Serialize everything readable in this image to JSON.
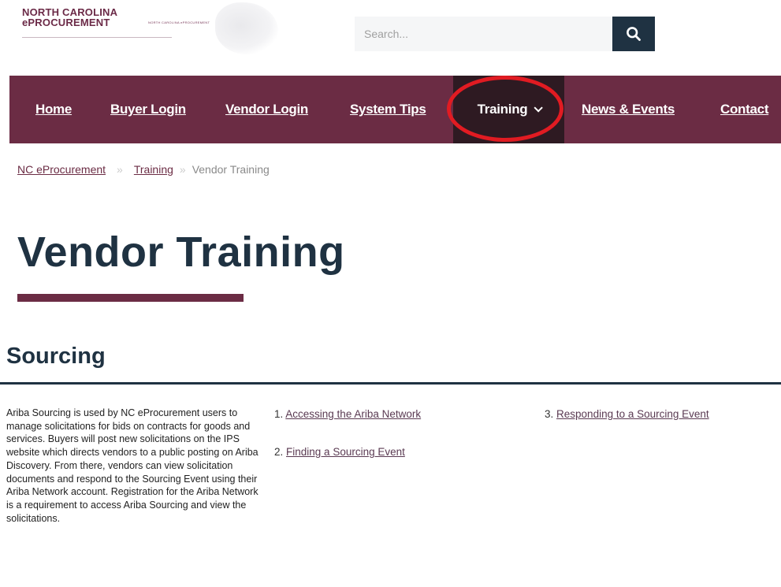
{
  "header": {
    "logo_line1": "NORTH CAROLINA",
    "logo_line2": "ePROCUREMENT",
    "logo_tagline": "NORTH CAROLINA ePROCUREMENT"
  },
  "search": {
    "placeholder": "Search...",
    "button_icon": "search-icon"
  },
  "nav": {
    "items": [
      {
        "label": "Home"
      },
      {
        "label": "Buyer Login"
      },
      {
        "label": "Vendor Login"
      },
      {
        "label": "System Tips"
      },
      {
        "label": "Training",
        "active": true,
        "icon": "chevron-down-icon"
      },
      {
        "label": "News & Events"
      },
      {
        "label": "Contact"
      }
    ],
    "highlight_color": "#e11b22"
  },
  "breadcrumb": {
    "items": [
      {
        "label": "NC eProcurement"
      },
      {
        "label": "Training"
      },
      {
        "label": "Vendor Training"
      }
    ]
  },
  "page": {
    "title": "Vendor Training",
    "section_title": "Sourcing",
    "description": "Ariba Sourcing is used by NC eProcurement users to manage solicitations for bids on contracts for goods and services. Buyers will post new solicitations on the IPS website which directs vendors to a public posting on Ariba Discovery. From there, vendors can view solicitation documents and respond to the Sourcing Event using their Ariba Network account. Registration for the Ariba Network is a requirement to access Ariba Sourcing and view the solicitations.",
    "links": [
      {
        "number": "1.",
        "label": "Accessing the Ariba Network"
      },
      {
        "number": "2.",
        "label": "Finding a Sourcing Event"
      },
      {
        "number": "3.",
        "label": "Responding to a Sourcing Event"
      }
    ]
  },
  "colors": {
    "brand_maroon": "#6b2c44",
    "navy": "#1f3242",
    "nav_active": "#2e1a22"
  }
}
